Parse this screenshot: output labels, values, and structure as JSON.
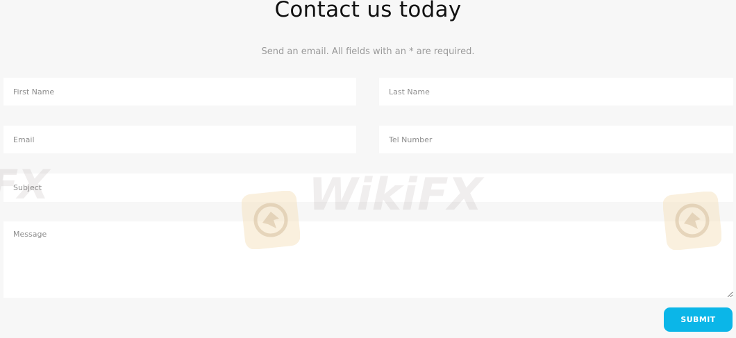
{
  "heading": "Contact us today",
  "subheading": "Send an email. All fields with an * are required.",
  "form": {
    "first_name_placeholder": "First Name",
    "last_name_placeholder": "Last Name",
    "email_placeholder": "Email",
    "tel_placeholder": "Tel Number",
    "subject_placeholder": "Subject",
    "message_placeholder": "Message",
    "submit_label": "SUBMIT"
  },
  "watermark": {
    "text": "WikiFX",
    "fragment": "FX",
    "logo_icon": "wikifx-eagle-logo-icon"
  },
  "colors": {
    "submit_bg": "#0bb6e8",
    "background": "#f7f7f7",
    "watermark_badge": "#f6e3c3"
  }
}
